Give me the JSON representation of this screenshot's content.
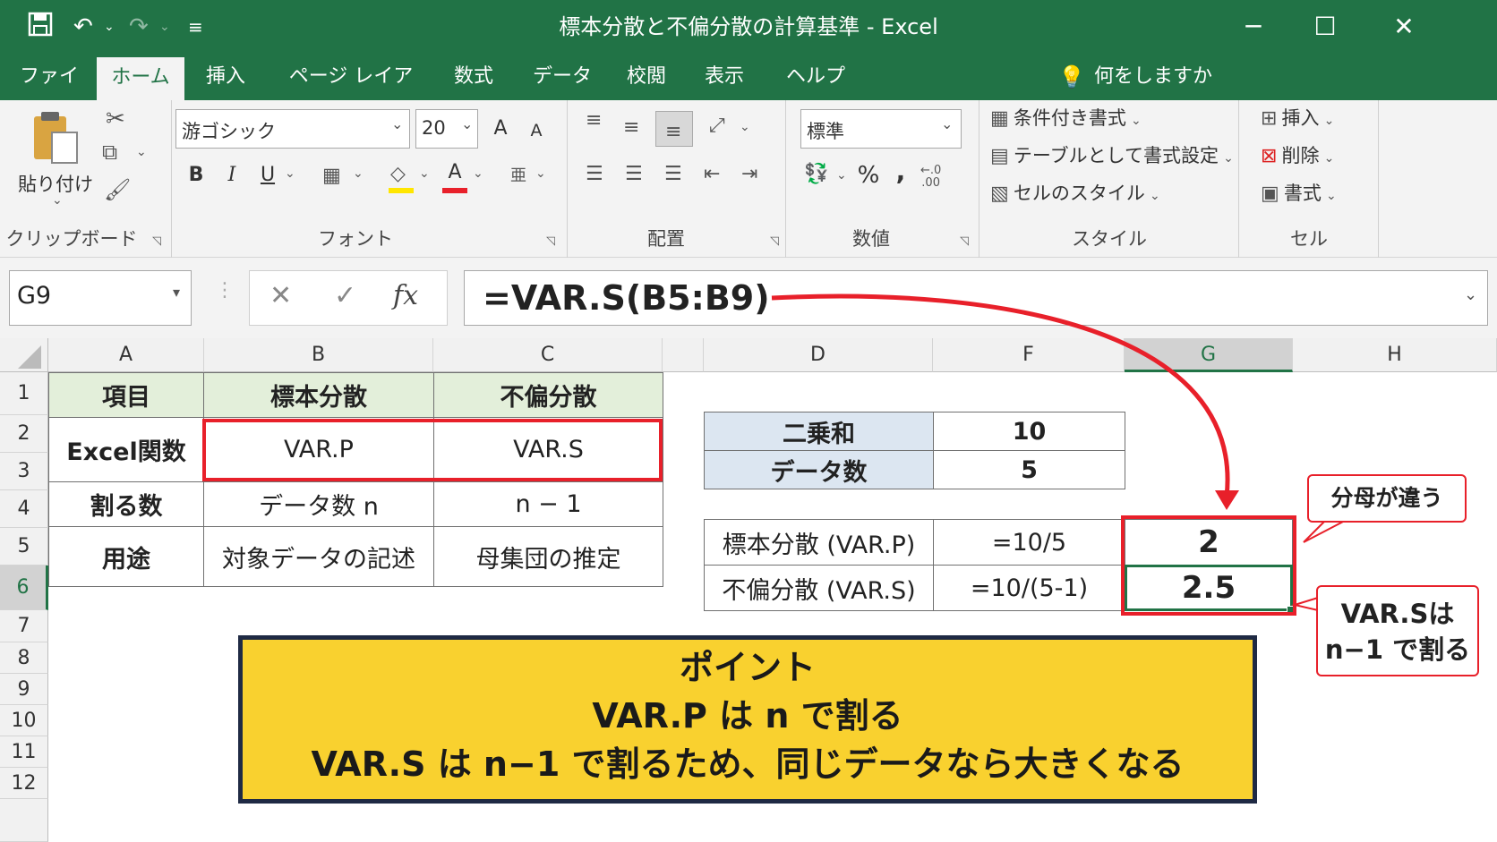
{
  "window": {
    "title": "標本分散と不偏分散の計算基準 - Excel"
  },
  "tabs": [
    "ファイル",
    "ホーム",
    "挿入",
    "ページ レイアウト",
    "数式",
    "データ",
    "校閲",
    "表示",
    "ヘルプ"
  ],
  "tell_me": "何をしますか",
  "ribbon": {
    "clipboard": {
      "paste": "貼り付け",
      "label": "クリップボード"
    },
    "font": {
      "name": "游ゴシック",
      "size": "20",
      "label": "フォント",
      "bold": "B",
      "italic": "I",
      "underline": "U",
      "grow": "A",
      "shrink": "A",
      "font_color": "A"
    },
    "alignment": {
      "label": "配置"
    },
    "number": {
      "format": "標準",
      "label": "数値",
      "percent": "%",
      "comma": ","
    },
    "styles": {
      "conditional": "条件付き書式",
      "table": "テーブルとして書式設定",
      "cell_styles": "セルのスタイル",
      "label": "スタイル"
    },
    "cells": {
      "insert": "挿入",
      "delete": "削除",
      "format": "書式",
      "label": "セル"
    }
  },
  "formula_bar": {
    "name_box": "G9",
    "fx": "fx",
    "formula": "=VAR.S(B5:B9)"
  },
  "columns": [
    "A",
    "B",
    "C",
    "D",
    "F",
    "G",
    "H"
  ],
  "rows": [
    "1",
    "2",
    "3",
    "4",
    "5",
    "6",
    "7",
    "8",
    "9",
    "10",
    "11",
    "12"
  ],
  "table_left": {
    "headers": [
      "項目",
      "標本分散",
      "不偏分散"
    ],
    "row_function": [
      "Excel関数",
      "VAR.P",
      "VAR.S"
    ],
    "row_divide": [
      "割る数",
      "データ数 n",
      "n − 1"
    ],
    "row_use": [
      "用途",
      "対象データの記述",
      "母集団の推定"
    ]
  },
  "table_summary": {
    "sum_sq_label": "二乗和",
    "sum_sq_value": "10",
    "count_label": "データ数",
    "count_value": "5"
  },
  "table_calc": {
    "varp_label": "標本分散 (VAR.P)",
    "varp_formula": "=10/5",
    "varp_result": "2",
    "vars_label": "不偏分散 (VAR.S)",
    "vars_formula": "=10/(5-1)",
    "vars_result": "2.5"
  },
  "callouts": {
    "denominator": "分母が違う",
    "vars_line1": "VAR.Sは",
    "vars_line2": "n−1 で割る"
  },
  "point_box": {
    "title": "ポイント",
    "line1": "VAR.P は n で割る",
    "line2": "VAR.S は n−1 で割るため、同じデータなら大きくなる"
  },
  "colors": {
    "excel_green": "#217346",
    "highlight_red": "#e8202a",
    "point_yellow": "#f9d12f",
    "point_border": "#1f2a44",
    "header_green": "#e3efda",
    "header_blue": "#dce6f1"
  }
}
